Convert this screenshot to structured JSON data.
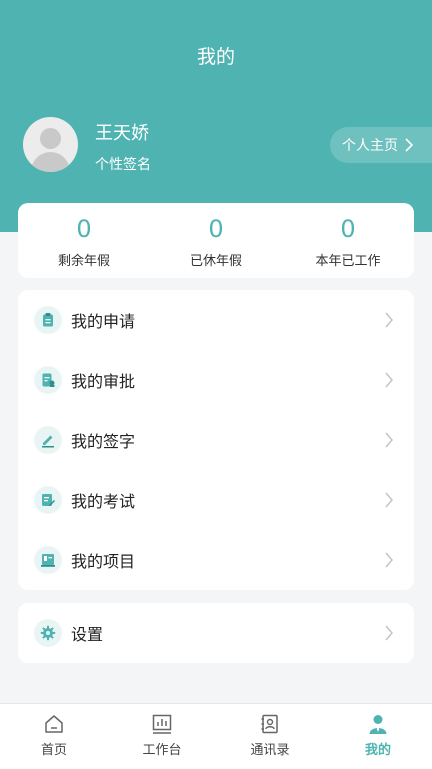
{
  "header": {
    "title": "我的"
  },
  "user": {
    "name": "王天娇",
    "signature": "个性签名"
  },
  "profile_button": {
    "label": "个人主页"
  },
  "stats": [
    {
      "value": "0",
      "label": "剩余年假"
    },
    {
      "value": "0",
      "label": "已休年假"
    },
    {
      "value": "0",
      "label": "本年已工作"
    }
  ],
  "menu": [
    {
      "label": "我的申请",
      "icon": "clipboard-icon"
    },
    {
      "label": "我的审批",
      "icon": "approval-icon"
    },
    {
      "label": "我的签字",
      "icon": "pen-icon"
    },
    {
      "label": "我的考试",
      "icon": "exam-icon"
    },
    {
      "label": "我的项目",
      "icon": "project-icon"
    }
  ],
  "settings": {
    "label": "设置",
    "icon": "gear-icon"
  },
  "tabbar": [
    {
      "label": "首页",
      "icon": "home-icon"
    },
    {
      "label": "工作台",
      "icon": "chart-board-icon"
    },
    {
      "label": "通讯录",
      "icon": "contacts-icon"
    },
    {
      "label": "我的",
      "icon": "person-icon",
      "active": true
    }
  ],
  "colors": {
    "accent": "#4fb4b1",
    "background": "#f4f5f7"
  }
}
